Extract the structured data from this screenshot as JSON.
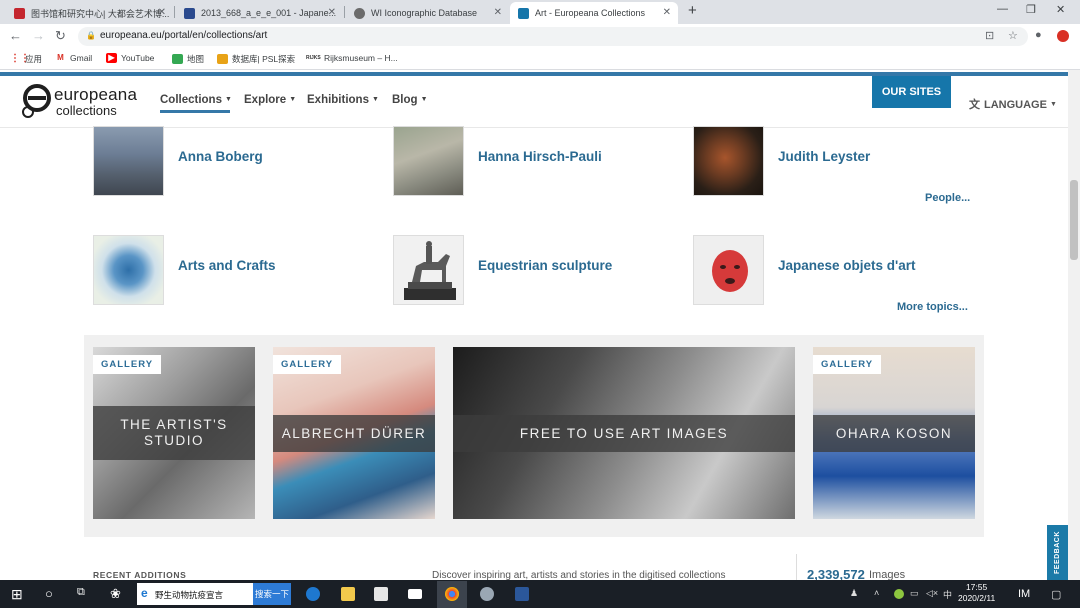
{
  "browser": {
    "tabs": [
      {
        "title": "图书馆和研究中心| 大都会艺术博...",
        "fav_color": "#c4262e"
      },
      {
        "title": "2013_668_a_e_e_001 - Japane...",
        "fav_color": "#2a4a8e"
      },
      {
        "title": "WI Iconographic Database",
        "fav_color": "#6b6b6b"
      },
      {
        "title": "Art - Europeana Collections",
        "fav_color": "#1676aa"
      }
    ],
    "new_tab": "+",
    "url": "europeana.eu/portal/en/collections/art",
    "bookmarks": [
      {
        "label": "应用",
        "icon": "apps-grid"
      },
      {
        "label": "Gmail",
        "icon": "gmail"
      },
      {
        "label": "YouTube",
        "icon": "youtube"
      },
      {
        "label": "地图",
        "icon": "maps"
      },
      {
        "label": "数据库| PSL探索",
        "icon": "psl"
      },
      {
        "label": "Rijksmuseum – H...",
        "icon": "rijks",
        "icon_text": "RIJKS"
      }
    ]
  },
  "site": {
    "logo_word": "europeana",
    "logo_sub": "collections",
    "nav": [
      "Collections",
      "Explore",
      "Exhibitions",
      "Blog"
    ],
    "our_sites": "OUR SITES",
    "language": "LANGUAGE"
  },
  "people": {
    "items": [
      "Anna Boberg",
      "Hanna Hirsch-Pauli",
      "Judith Leyster"
    ],
    "more": "People..."
  },
  "topics": {
    "items": [
      "Arts and Crafts",
      "Equestrian sculpture",
      "Japanese objets d'art"
    ],
    "more": "More topics..."
  },
  "gallery": {
    "cards": [
      {
        "badge": "GALLERY",
        "title_line1": "THE ARTIST'S",
        "title_line2": "STUDIO"
      },
      {
        "badge": "GALLERY",
        "title_line1": "ALBRECHT DÜRER",
        "title_line2": ""
      },
      {
        "badge": "",
        "title_line1": "FREE TO USE ART IMAGES",
        "title_line2": ""
      },
      {
        "badge": "GALLERY",
        "title_line1": "OHARA KOSON",
        "title_line2": ""
      }
    ]
  },
  "bottom": {
    "recent": "RECENT ADDITIONS",
    "desc": "Discover inspiring art, artists and stories in the digitised collections",
    "count": "2,339,572",
    "count_unit": "Images"
  },
  "feedback": "FEEDBACK",
  "taskbar": {
    "search_text": "野生动物抗疫宣言",
    "search_button": "搜索一下",
    "time": "17:55",
    "date": "2020/2/11"
  },
  "colors": {
    "brand_blue": "#1676aa",
    "link_blue": "#2b6a91"
  }
}
